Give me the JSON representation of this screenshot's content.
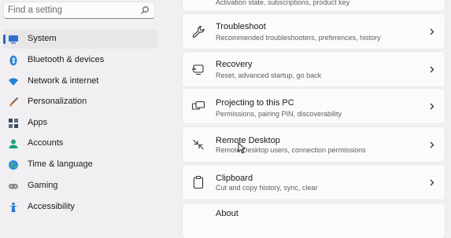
{
  "search": {
    "placeholder": "Find a setting",
    "icon": "search-icon"
  },
  "sidebar": {
    "accent": "#2b63c0",
    "items": [
      {
        "label": "System",
        "icon": "system-icon",
        "active": true
      },
      {
        "label": "Bluetooth & devices",
        "icon": "bluetooth-icon"
      },
      {
        "label": "Network & internet",
        "icon": "wifi-icon"
      },
      {
        "label": "Personalization",
        "icon": "brush-icon"
      },
      {
        "label": "Apps",
        "icon": "apps-icon"
      },
      {
        "label": "Accounts",
        "icon": "person-icon"
      },
      {
        "label": "Time & language",
        "icon": "globe-icon"
      },
      {
        "label": "Gaming",
        "icon": "gamepad-icon"
      },
      {
        "label": "Accessibility",
        "icon": "accessibility-icon"
      }
    ]
  },
  "cards": [
    {
      "title": "",
      "subtitle": "Activation state, subscriptions, product key",
      "icon": "key-icon"
    },
    {
      "title": "Troubleshoot",
      "subtitle": "Recommended troubleshooters, preferences, history",
      "icon": "wrench-icon"
    },
    {
      "title": "Recovery",
      "subtitle": "Reset, advanced startup, go back",
      "icon": "recovery-icon"
    },
    {
      "title": "Projecting to this PC",
      "subtitle": "Permissions, pairing PIN, discoverability",
      "icon": "projector-icon"
    },
    {
      "title": "Remote Desktop",
      "subtitle": "Remote Desktop users, connection permissions",
      "icon": "remote-desktop-icon"
    },
    {
      "title": "Clipboard",
      "subtitle": "Cut and copy history, sync, clear",
      "icon": "clipboard-icon"
    },
    {
      "title": "About",
      "subtitle": "",
      "icon": "info-icon"
    }
  ]
}
